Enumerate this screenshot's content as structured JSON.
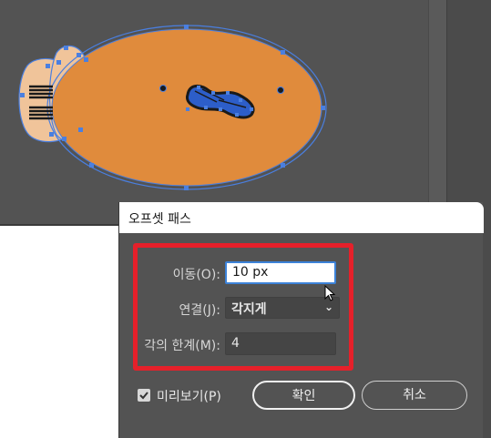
{
  "dialog": {
    "title": "오프셋 패스",
    "offset_label": "이동(O):",
    "offset_value": "10 px",
    "joins_label": "연결(J):",
    "joins_value": "각지게",
    "miter_label": "각의 한계(M):",
    "miter_value": "4",
    "preview_label": "미리보기(P)",
    "preview_checked": true,
    "ok_label": "확인",
    "cancel_label": "취소"
  },
  "colors": {
    "canvas": "#535353",
    "shape_fill": "#e08b3c",
    "shape_fill_light": "#f0c49a",
    "selection": "#4a7fe0",
    "highlight": "#e5202a",
    "field_focus": "#3c82d8"
  },
  "icons": [
    "chevron-down-icon",
    "checkmark-icon",
    "mouse-cursor-icon"
  ]
}
